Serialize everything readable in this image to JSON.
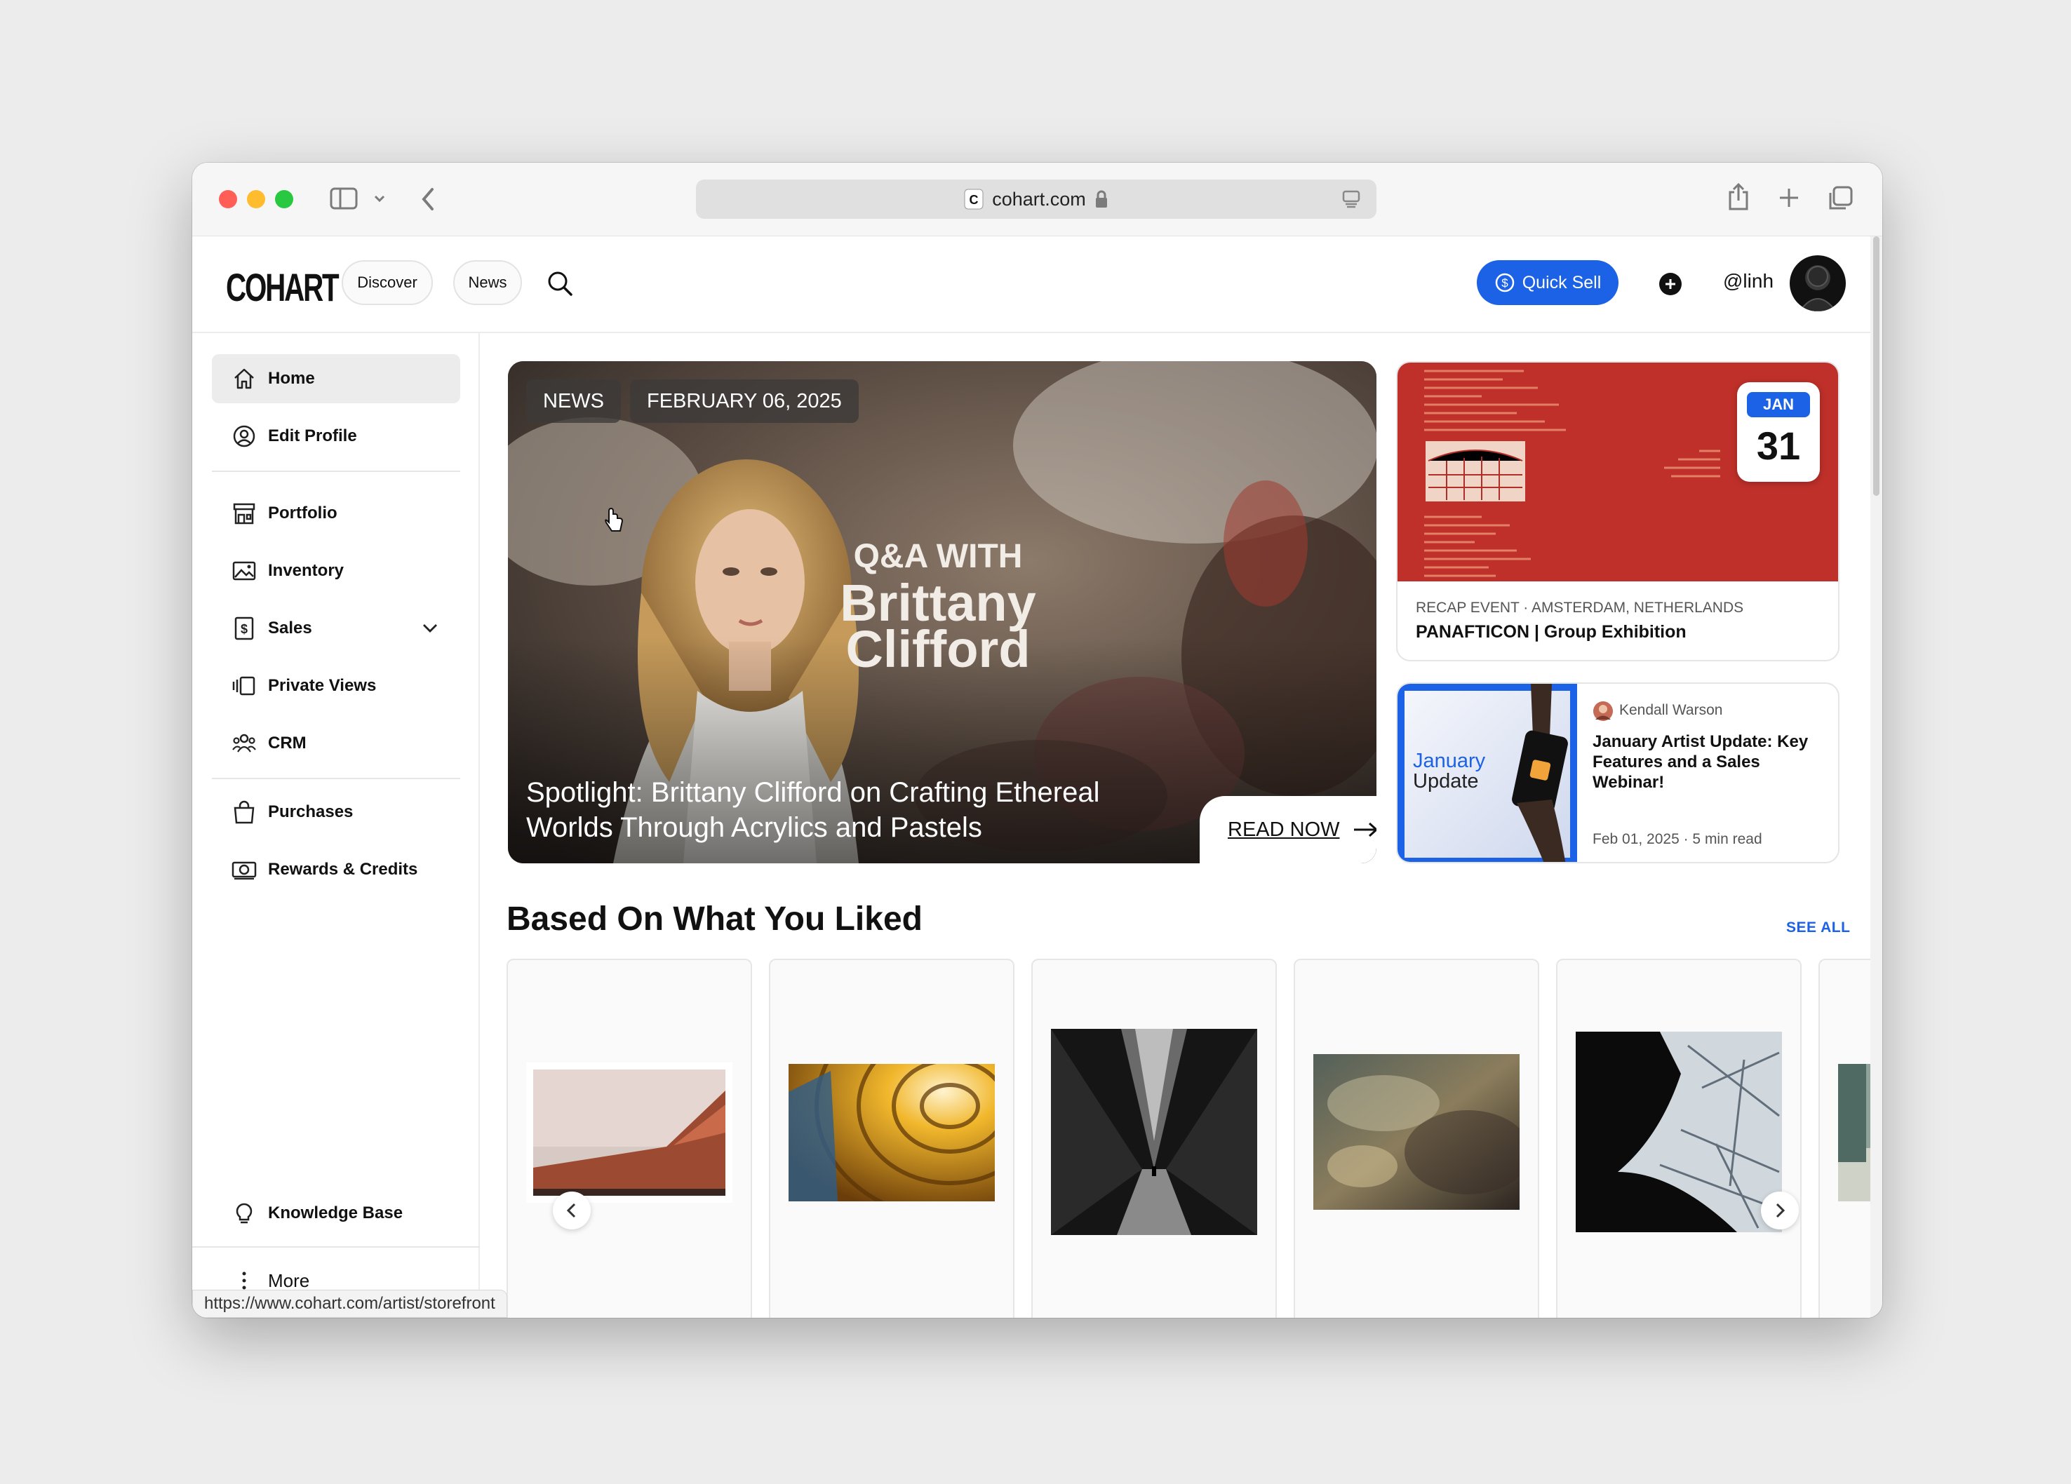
{
  "browser": {
    "url_display": "cohart.com",
    "status_url": "https://www.cohart.com/artist/storefront"
  },
  "header": {
    "logo": "COHART",
    "discover_label": "Discover",
    "news_label": "News",
    "quick_sell_label": "Quick Sell",
    "username": "@linh",
    "colors": {
      "accent": "#1c62e6"
    }
  },
  "sidebar": {
    "items": [
      {
        "label": "Home",
        "icon": "home-icon",
        "active": true
      },
      {
        "label": "Edit Profile",
        "icon": "user-circle-icon"
      },
      {
        "label": "Portfolio",
        "icon": "storefront-icon"
      },
      {
        "label": "Inventory",
        "icon": "image-icon"
      },
      {
        "label": "Sales",
        "icon": "dollar-doc-icon"
      },
      {
        "label": "Private Views",
        "icon": "private-views-icon"
      },
      {
        "label": "CRM",
        "icon": "people-icon"
      },
      {
        "label": "Purchases",
        "icon": "shopping-bag-icon"
      },
      {
        "label": "Rewards & Credits",
        "icon": "credits-icon"
      }
    ],
    "knowledge_base": "Knowledge Base",
    "more": "More"
  },
  "hero": {
    "tag": "NEWS",
    "date": "FEBRUARY 06, 2025",
    "overlay_line1": "Q&A WITH",
    "overlay_line2": "Brittany",
    "overlay_line3": "Clifford",
    "headline": "Spotlight: Brittany Clifford on Crafting Ethereal Worlds Through Acrylics and Pastels",
    "cta": "READ NOW"
  },
  "event_card": {
    "month": "JAN",
    "day": "31",
    "meta": "RECAP EVENT · AMSTERDAM, NETHERLANDS",
    "title": "PANAFTICON | Group Exhibition"
  },
  "article_card": {
    "thumb_line1": "January",
    "thumb_line2": "Update",
    "author": "Kendall Warson",
    "title": "January Artist Update: Key Features and a Sales Webinar!",
    "meta": "Feb 01, 2025 · 5 min read"
  },
  "recommendations": {
    "title": "Based On What You Liked",
    "see_all": "SEE ALL"
  }
}
